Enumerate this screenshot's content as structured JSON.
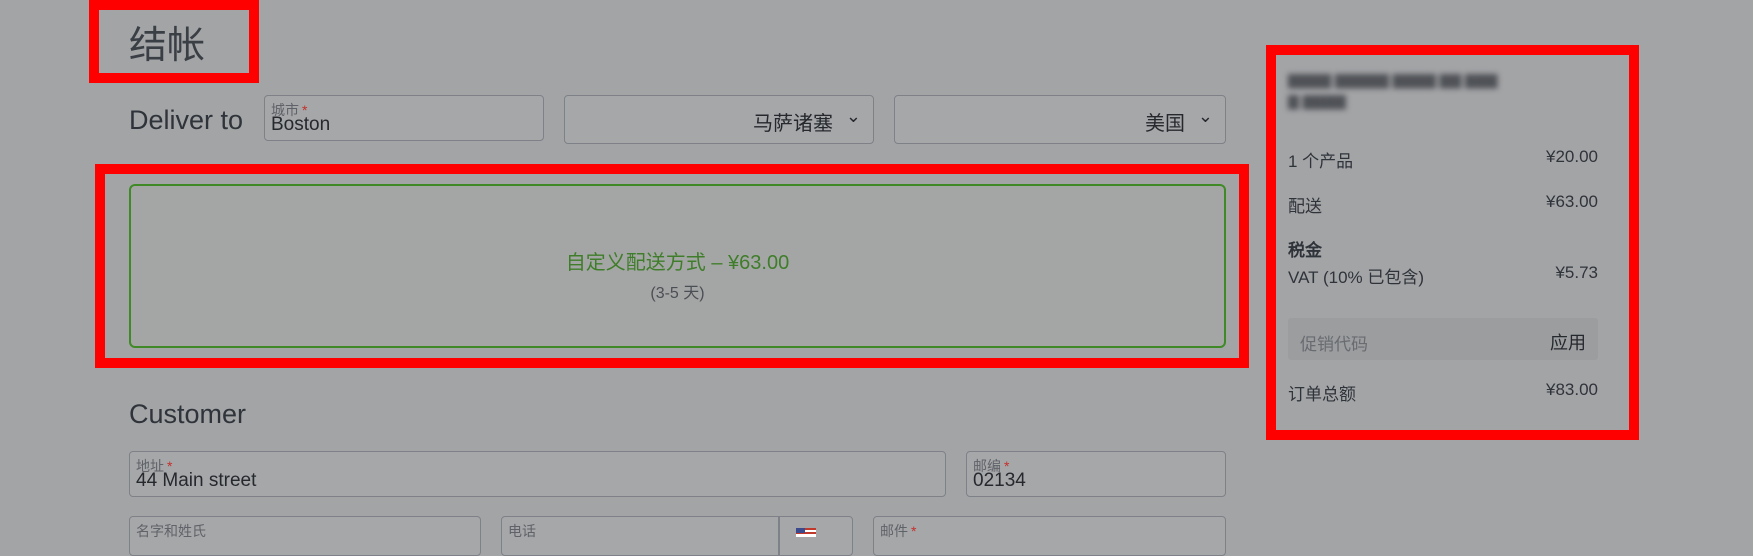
{
  "page": {
    "title": "结帐"
  },
  "deliver": {
    "heading": "Deliver to",
    "city": {
      "label": "城市",
      "required": "*",
      "value": "Boston"
    },
    "state": {
      "value": "马萨诸塞"
    },
    "country": {
      "value": "美国"
    }
  },
  "shipping": {
    "method": "自定义配送方式 – ¥63.00",
    "days": "(3-5 天)"
  },
  "customer": {
    "heading": "Customer",
    "address": {
      "label": "地址",
      "required": "*",
      "value": "44 Main street"
    },
    "zip": {
      "label": "邮编",
      "required": "*",
      "value": "02134"
    },
    "name": {
      "label": "名字和姓氏"
    },
    "phone": {
      "label": "电话"
    },
    "email": {
      "label": "邮件",
      "required": "*"
    }
  },
  "summary": {
    "products_label": "1 个产品",
    "products_value": "¥20.00",
    "shipping_label": "配送",
    "shipping_value": "¥63.00",
    "tax_heading": "税金",
    "vat_label": "VAT (10% 已包含)",
    "vat_value": "¥5.73",
    "promo_placeholder": "促销代码",
    "apply_label": "应用",
    "total_label": "订单总额",
    "total_value": "¥83.00"
  },
  "colors": {
    "highlight": "#ff0000",
    "shipping_selected": "#3f8a26",
    "required": "#c4302b"
  },
  "icons": {
    "select_chevron": "chevron-down-icon",
    "phone_country": "us-flag-icon"
  }
}
